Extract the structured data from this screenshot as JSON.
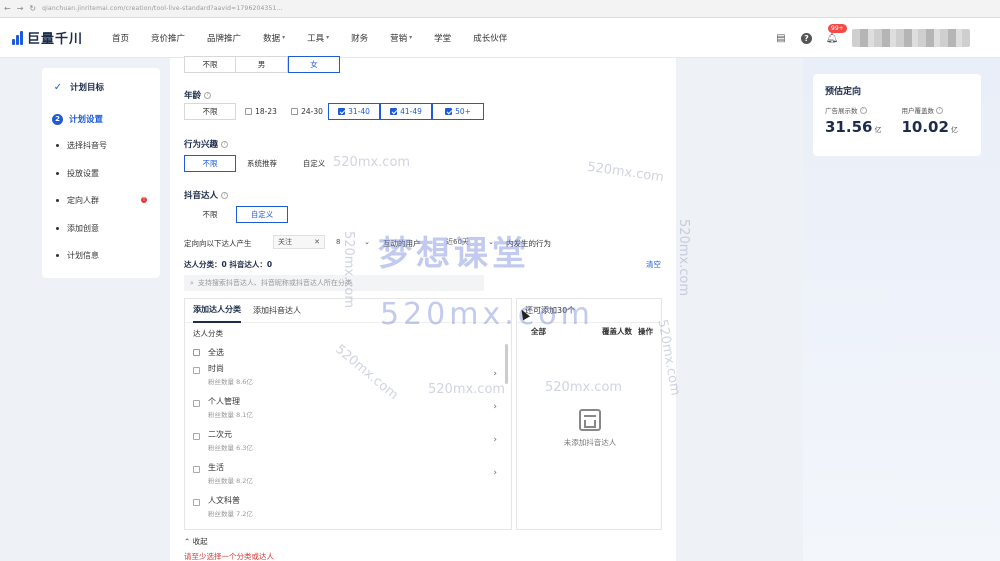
{
  "browser": {
    "url": "qianchuan.jinritemai.com/creation/tool-live-standard?aavid=1796204351..."
  },
  "nav": {
    "logo": "巨量千川",
    "menu": [
      {
        "label": "首页",
        "caret": false
      },
      {
        "label": "竞价推广",
        "caret": false
      },
      {
        "label": "品牌推广",
        "caret": false
      },
      {
        "label": "数据",
        "caret": true
      },
      {
        "label": "工具",
        "caret": true
      },
      {
        "label": "财务",
        "caret": false
      },
      {
        "label": "营销",
        "caret": true
      },
      {
        "label": "学堂",
        "caret": false
      },
      {
        "label": "成长伙伴",
        "caret": false
      }
    ],
    "badge": "99+"
  },
  "sidebar": {
    "step1": "计划目标",
    "step2_num": "2",
    "step2": "计划设置",
    "items": [
      "选择抖音号",
      "投放设置",
      "定向人群",
      "添加创意",
      "计划信息"
    ]
  },
  "gender": {
    "options": [
      "不限",
      "男",
      "女"
    ],
    "selected": "女"
  },
  "age": {
    "label": "年龄",
    "options": [
      {
        "label": "不限",
        "checkbox": false,
        "checked": false
      },
      {
        "label": "18-23",
        "checkbox": true,
        "checked": false
      },
      {
        "label": "24-30",
        "checkbox": true,
        "checked": false
      },
      {
        "label": "31-40",
        "checkbox": true,
        "checked": true
      },
      {
        "label": "41-49",
        "checkbox": true,
        "checked": true
      },
      {
        "label": "50+",
        "checkbox": true,
        "checked": true
      }
    ]
  },
  "interest": {
    "label": "行为兴趣",
    "options": [
      "不限",
      "系统推荐",
      "自定义"
    ],
    "selected": "不限"
  },
  "douyin": {
    "label": "抖音达人",
    "options": [
      "不限",
      "自定义"
    ],
    "selected": "自定义"
  },
  "filter": {
    "prefix": "定向向以下达人产生",
    "follow": "关注",
    "count": "8",
    "interact": "互动的用户",
    "days": "近60天",
    "behavior": "内发生的行为"
  },
  "counts": {
    "text": "达人分类：0   抖音达人：0",
    "clear": "清空"
  },
  "search": {
    "placeholder": "支持搜索抖音达人、抖音昵称或抖音达人所在分类"
  },
  "left_pane": {
    "tabs": [
      "添加达人分类",
      "添加抖音达人"
    ],
    "section": "达人分类",
    "select_all": "全选",
    "categories": [
      {
        "name": "时尚",
        "fans": "粉丝数量 8.6亿"
      },
      {
        "name": "个人管理",
        "fans": "粉丝数量 8.1亿"
      },
      {
        "name": "二次元",
        "fans": "粉丝数量 6.3亿"
      },
      {
        "name": "生活",
        "fans": "粉丝数量 8.2亿"
      },
      {
        "name": "人文科普",
        "fans": "粉丝数量 7.2亿"
      }
    ]
  },
  "right_pane": {
    "header": "还可添加30个",
    "cols": [
      "全部",
      "覆盖人数",
      "操作"
    ],
    "empty": "未添加抖音达人"
  },
  "collapse": "收起",
  "warning": "请至少选择一个分类或达人",
  "estimate": {
    "title": "预估定向",
    "impressions_label": "广告展示数",
    "impressions": "31.56",
    "impressions_unit": "亿",
    "users_label": "用户覆盖数",
    "users": "10.02",
    "users_unit": "亿"
  },
  "watermarks": {
    "cn": "梦想课堂",
    "site": "520mx.com"
  }
}
